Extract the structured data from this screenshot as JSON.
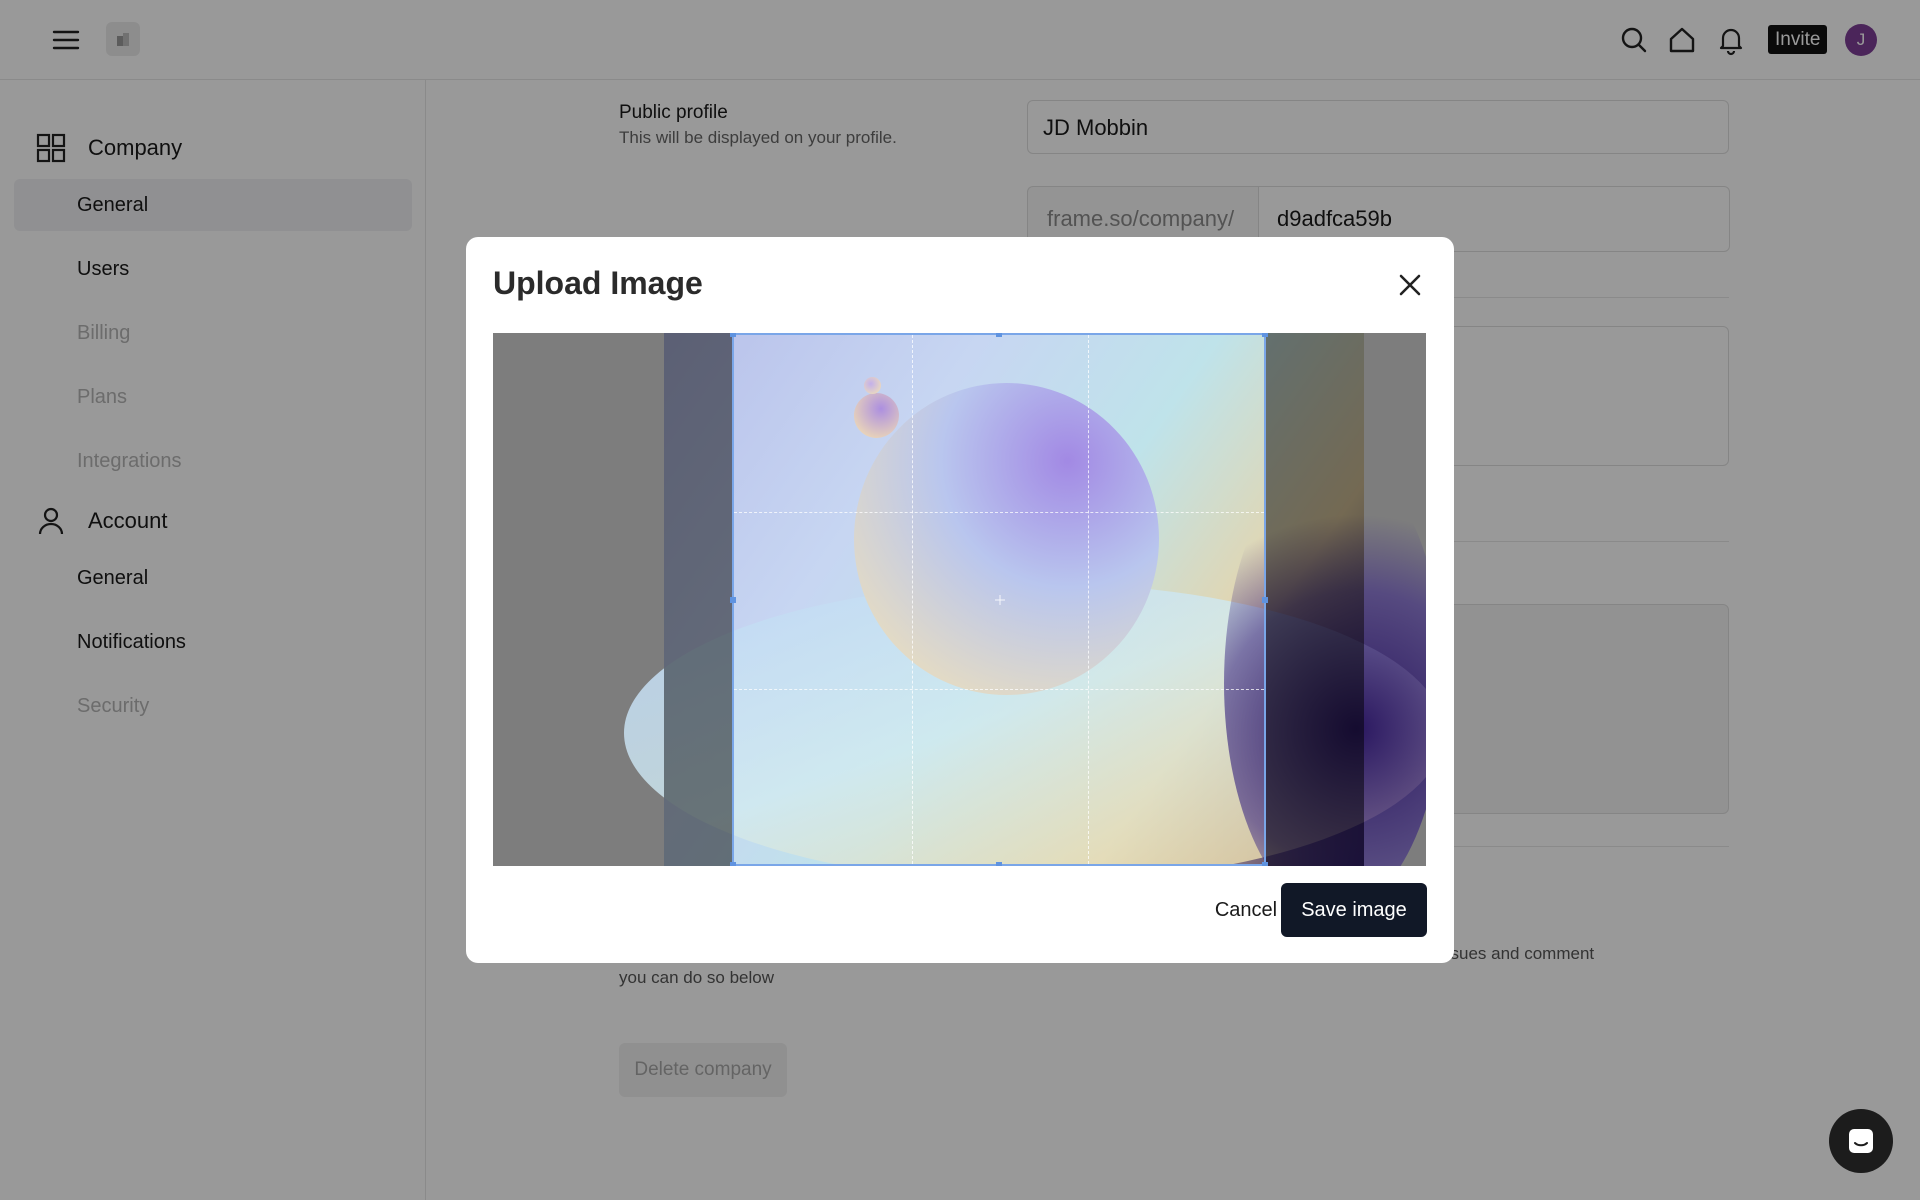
{
  "topbar": {
    "invite_label": "Invite",
    "avatar_initial": "J",
    "avatar_color": "#7e3f97"
  },
  "sidebar": {
    "company_section": "Company",
    "company_items": [
      {
        "label": "General",
        "active": true
      },
      {
        "label": "Users"
      },
      {
        "label": "Billing",
        "muted": true
      },
      {
        "label": "Plans",
        "muted": true
      },
      {
        "label": "Integrations",
        "muted": true
      }
    ],
    "account_section": "Account",
    "account_items": [
      {
        "label": "General"
      },
      {
        "label": "Notifications"
      },
      {
        "label": "Security",
        "muted": true
      }
    ]
  },
  "main": {
    "public_profile_title": "Public profile",
    "public_profile_sub": "This will be displayed on your profile.",
    "company_name_value": "JD Mobbin",
    "url_prefix": "frame.so/company/",
    "url_value": "d9adfca59b",
    "delete_text_fragment_right": "ssues and comment",
    "delete_text_fragment_left": "you can do so below",
    "delete_button_label": "Delete company"
  },
  "modal": {
    "title": "Upload Image",
    "cancel_label": "Cancel",
    "save_label": "Save image"
  },
  "colors": {
    "primary_dark": "#111827",
    "crop_border": "#7aa6e8",
    "overlay": "rgba(0,0,0,0.4)"
  },
  "icons": [
    "menu-icon",
    "building-icon",
    "search-icon",
    "home-icon",
    "bell-icon",
    "grid-icon",
    "user-icon",
    "close-icon",
    "chat-icon",
    "crosshair-icon"
  ]
}
